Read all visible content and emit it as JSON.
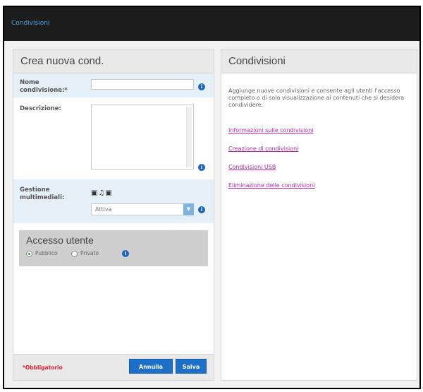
{
  "header": {
    "title": "Condivisioni"
  },
  "left_panel": {
    "title": "Crea nuova cond.",
    "share_name": {
      "label": "Nome condivisione:*",
      "value": ""
    },
    "description": {
      "label": "Descrizione:",
      "value": ""
    },
    "media": {
      "label": "Gestione multimediali:",
      "icons": [
        "photo-icon",
        "music-icon",
        "video-icon"
      ],
      "selected": "Attiva"
    },
    "access": {
      "title": "Accesso utente",
      "options": [
        "Pubblico",
        "Privato"
      ],
      "selected": "Pubblico"
    },
    "footer": {
      "required_note": "*Obbligatorio",
      "cancel_label": "Annulla",
      "save_label": "Salva"
    }
  },
  "right_panel": {
    "title": "Condivisioni",
    "description": "Aggiunge nuove condivisioni e consente agli utenti l'accesso completo o di sola visualizzazione ai contenuti che si desidera condividere.",
    "links": [
      "Informazioni sulle condivisioni",
      "Creazione di condivisioni",
      "Condivisioni USB",
      "Eliminazione delle condivisioni"
    ]
  },
  "colors": {
    "accent": "#1f6fc7",
    "link": "#b427b0",
    "required": "#dd2233",
    "header_bg": "#1c1c1c"
  }
}
